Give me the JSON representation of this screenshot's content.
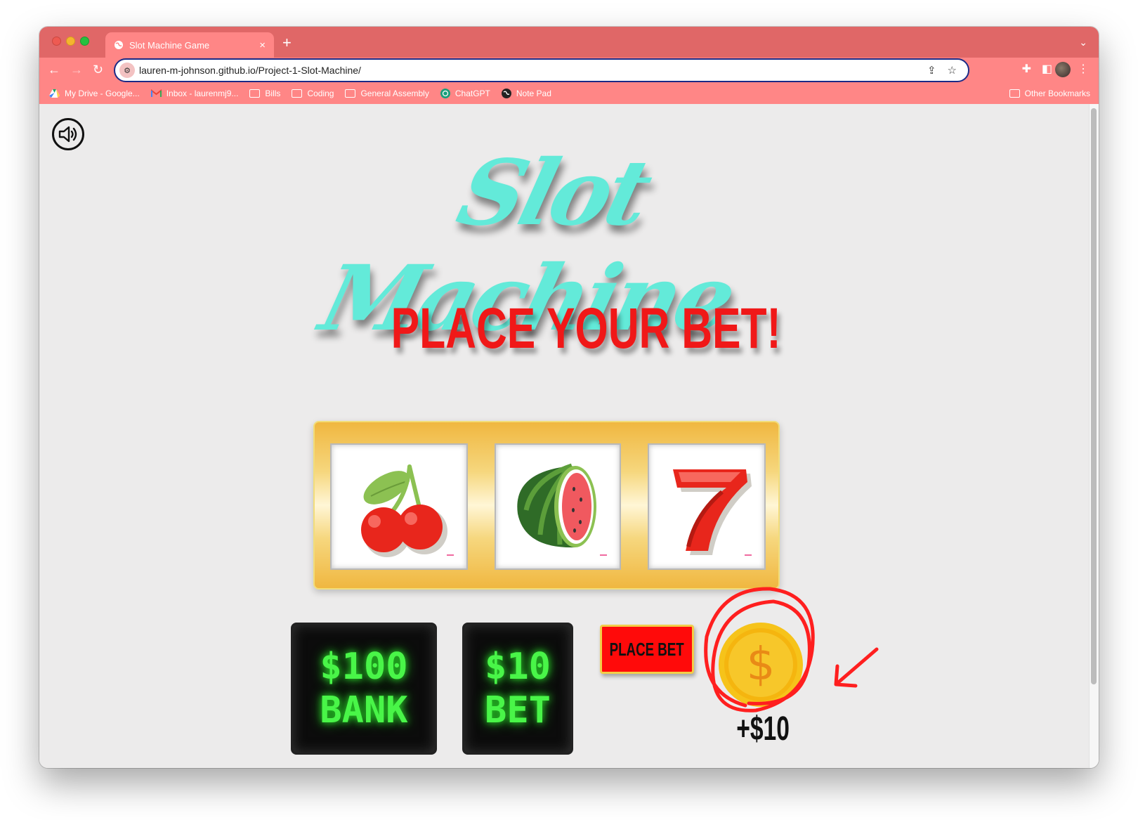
{
  "browser": {
    "tab_title": "Slot Machine Game",
    "tab_close": "×",
    "new_tab": "+",
    "tab_menu": "⌄",
    "url": "lauren-m-johnson.github.io/Project-1-Slot-Machine/",
    "back": "←",
    "forward": "→",
    "reload": "↻",
    "bookmarks": [
      {
        "label": "My Drive - Google...",
        "icon": "google-drive-icon"
      },
      {
        "label": "Inbox - laurenmj9...",
        "icon": "gmail-icon"
      },
      {
        "label": "Bills",
        "icon": "folder-icon"
      },
      {
        "label": "Coding",
        "icon": "folder-icon"
      },
      {
        "label": "General Assembly",
        "icon": "folder-icon"
      },
      {
        "label": "ChatGPT",
        "icon": "chatgpt-icon"
      },
      {
        "label": "Note Pad",
        "icon": "globe-icon"
      }
    ],
    "other_bookmarks": "Other Bookmarks"
  },
  "page": {
    "logo": "Slot Machine",
    "headline": "PLACE YOUR BET!",
    "reels": [
      {
        "symbol": "cherry-icon"
      },
      {
        "symbol": "watermelon-icon"
      },
      {
        "symbol": "seven-icon"
      }
    ],
    "bank": {
      "amount": "$100",
      "label": "BANK"
    },
    "bet": {
      "amount": "$10",
      "label": "BET"
    },
    "place_bet_label": "PLACE BET",
    "coin_amount": "+$10",
    "colors": {
      "browser_chrome": "#ff8686",
      "logo": "#63ead9",
      "headline": "#f01818",
      "display_text": "#49f548",
      "button": "#ff0a0a"
    }
  }
}
